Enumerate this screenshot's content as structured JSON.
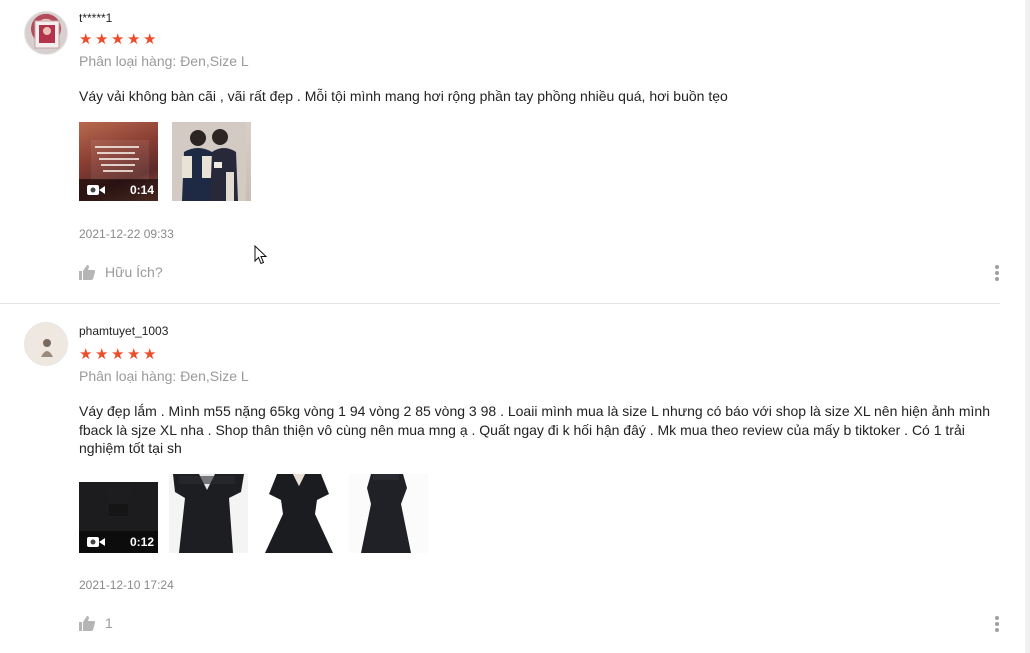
{
  "reviews": [
    {
      "username": "t*****1",
      "rating": 5,
      "variation": "Phân loại hàng: Đen,Size L",
      "comment": "Váy vải không bàn cãi , vãi rất đẹp . Mỗi tội mình mang hơi rộng phần tay phồng nhiều quá, hơi buồn tẹo",
      "video_duration": "0:14",
      "timestamp": "2021-12-22 09:33",
      "helpful_label": "Hữu Ích?"
    },
    {
      "username": "phamtuyet_1003",
      "rating": 5,
      "variation": "Phân loại hàng: Đen,Size L",
      "comment": "Váy đẹp lắm . Mình m55 nặng 65kg vòng 1 94 vòng 2 85 vòng 3 98 . Loaii mình mua là size L nhưng có báo với shop là size XL nên hiện ảnh mình fback là sjze XL nha . Shop thân thiện vô cùng nên mua mng ạ . Quất ngay đi k hối hận đâý . Mk mua theo review của mấy b tiktoker . Có 1 trải nghiệm tốt tại sh",
      "video_duration": "0:12",
      "timestamp": "2021-12-10 17:24",
      "helpful_label": "1"
    }
  ],
  "colors": {
    "star": "#ee4d2d",
    "muted_text": "#9a9a9a",
    "divider": "#e4e4e4"
  },
  "icons": {
    "star": "star-icon",
    "video": "video-camera-icon",
    "like": "thumbs-up-icon",
    "more": "more-vertical-icon"
  }
}
